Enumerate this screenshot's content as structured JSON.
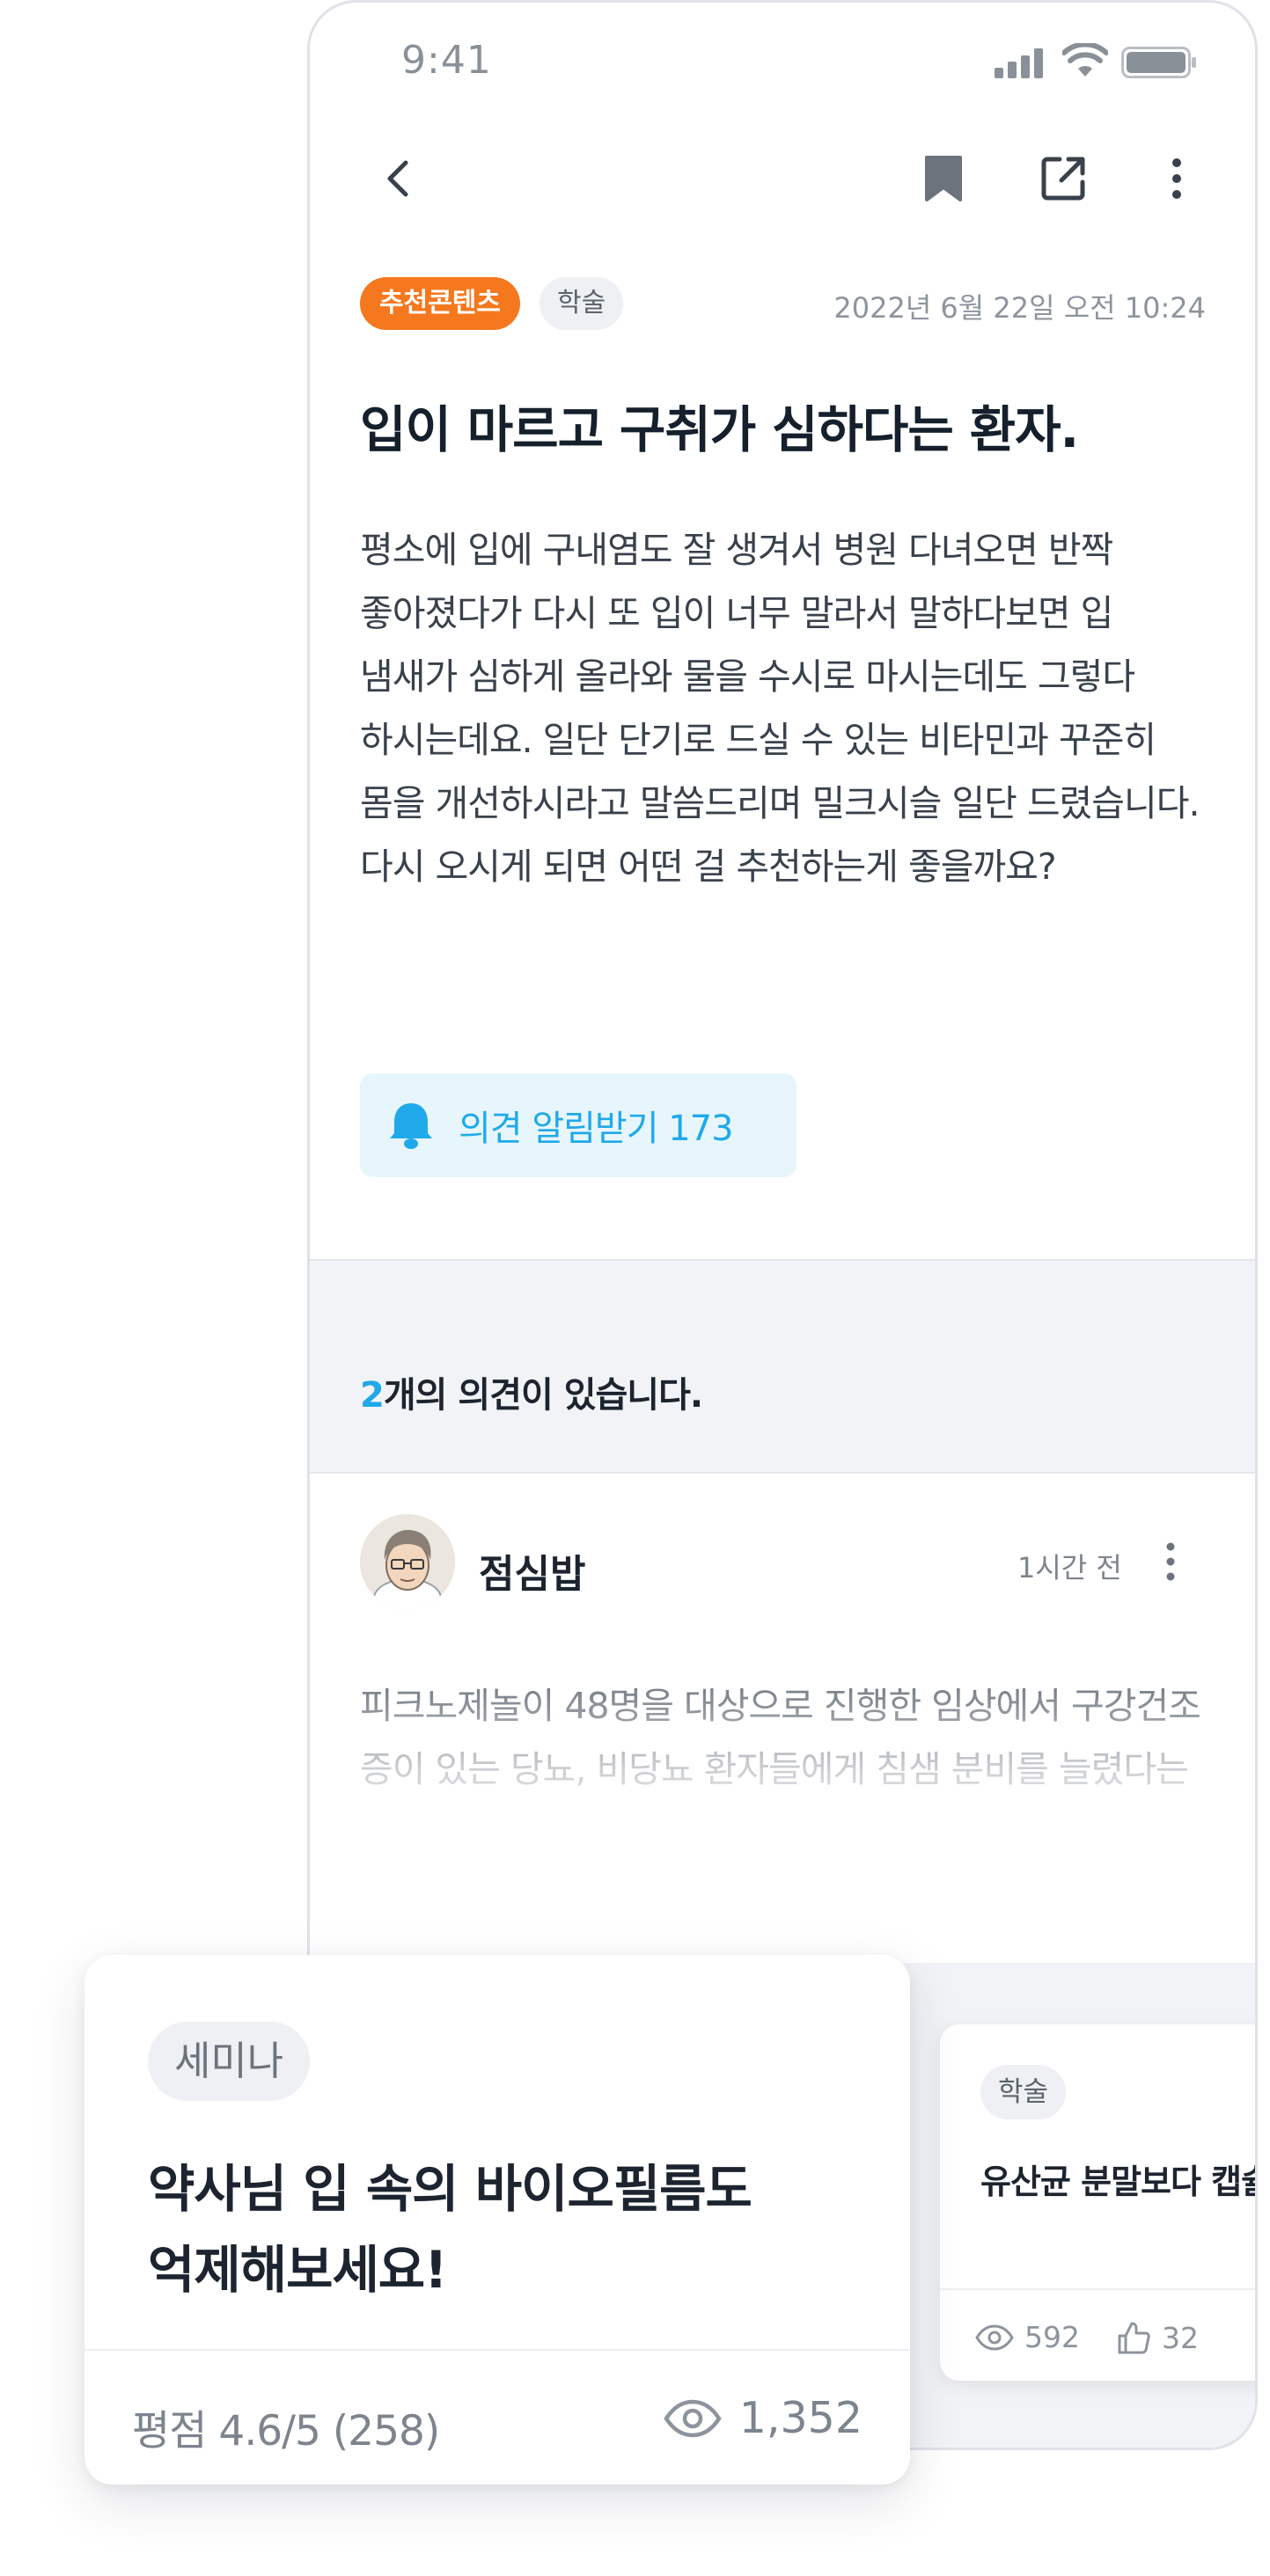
{
  "status_bar": {
    "time": "9:41"
  },
  "post": {
    "tags": {
      "recommended": "추천콘텐츠",
      "category": "학술"
    },
    "date": "2022년 6월 22일 오전 10:24",
    "title": "입이 마르고 구취가 심하다는 환자.",
    "body": "평소에 입에 구내염도 잘 생겨서 병원 다녀오면 반짝 좋아졌다가 다시 또 입이 너무 말라서 말하다보면 입 냄새가 심하게 올라와 물을 수시로 마시는데도 그렇다 하시는데요. 일단 단기로 드실 수 있는 비타민과 꾸준히 몸을 개선하시라고 말씀드리며 밀크시슬 일단 드렸습니다. 다시 오시게 되면 어떤 걸 추천하는게 좋을까요?",
    "notify_label": "의견 알림받기 173"
  },
  "comments": {
    "count": "2",
    "count_suffix": "개의 의견이 있습니다.",
    "items": [
      {
        "author": "점심밥",
        "time": "1시간 전",
        "text": "피크노제놀이 48명을 대상으로 진행한 임상에서 구강건조증이 있는 당뇨, 비당뇨 환자들에게 침샘 분비를 늘렸다는"
      }
    ]
  },
  "related_card": {
    "tag": "학술",
    "title": "유산균 분말보다 캡슐",
    "views": "592",
    "likes": "32"
  },
  "featured_card": {
    "tag": "세미나",
    "title_line1": "약사님 입 속의 바이오필름도",
    "title_line2": "억제해보세요!",
    "rating": "평점 4.6/5 (258)",
    "views": "1,352"
  },
  "colors": {
    "accent_blue": "#1fa9ea",
    "accent_orange": "#f5781f",
    "band_gray": "#f1f3f6"
  },
  "icons": [
    "back-icon",
    "bookmark-icon",
    "share-icon",
    "more-icon",
    "bell-icon",
    "eye-icon",
    "thumbs-up-icon"
  ]
}
